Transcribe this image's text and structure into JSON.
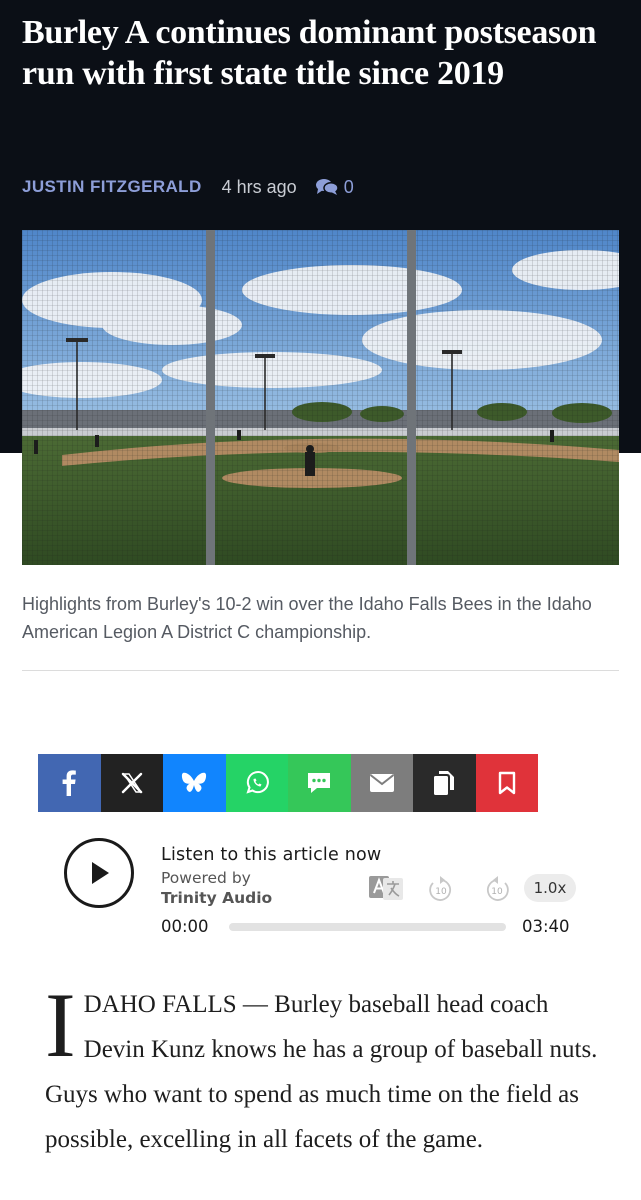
{
  "article": {
    "headline": "Burley A continues dominant postseason run with first state title since 2019",
    "author": "JUSTIN FITZGERALD",
    "time_ago": "4 hrs ago",
    "comment_count": "0",
    "caption": "Highlights from Burley's 10-2 win over the Idaho Falls Bees in the Idaho American Legion A District C championship.",
    "body_dropcap": "I",
    "body_text": "DAHO FALLS — Burley baseball head coach Devin Kunz knows he has a group of baseball nuts. Guys who want to spend as much time on the field as possible, excelling in all facets of the game."
  },
  "share_buttons": [
    {
      "name": "facebook",
      "icon": "facebook-icon",
      "color": "#4267b2"
    },
    {
      "name": "x",
      "icon": "x-icon",
      "color": "#222222"
    },
    {
      "name": "bluesky",
      "icon": "bluesky-icon",
      "color": "#1185fe"
    },
    {
      "name": "whatsapp",
      "icon": "whatsapp-icon",
      "color": "#25d366"
    },
    {
      "name": "sms",
      "icon": "sms-icon",
      "color": "#35c759"
    },
    {
      "name": "email",
      "icon": "email-icon",
      "color": "#7d7d7d"
    },
    {
      "name": "copy",
      "icon": "copy-icon",
      "color": "#2a2a2a"
    },
    {
      "name": "bookmark",
      "icon": "bookmark-icon",
      "color": "#e0333a"
    }
  ],
  "audio_player": {
    "title": "Listen to this article now",
    "powered_by": "Powered by",
    "brand": "Trinity Audio",
    "current_time": "00:00",
    "duration": "03:40",
    "speed": "1.0x",
    "skip_back": "10",
    "skip_forward": "10",
    "progress": 0
  },
  "colors": {
    "header_bg": "#0b0f16",
    "author": "#8d9ed8"
  }
}
